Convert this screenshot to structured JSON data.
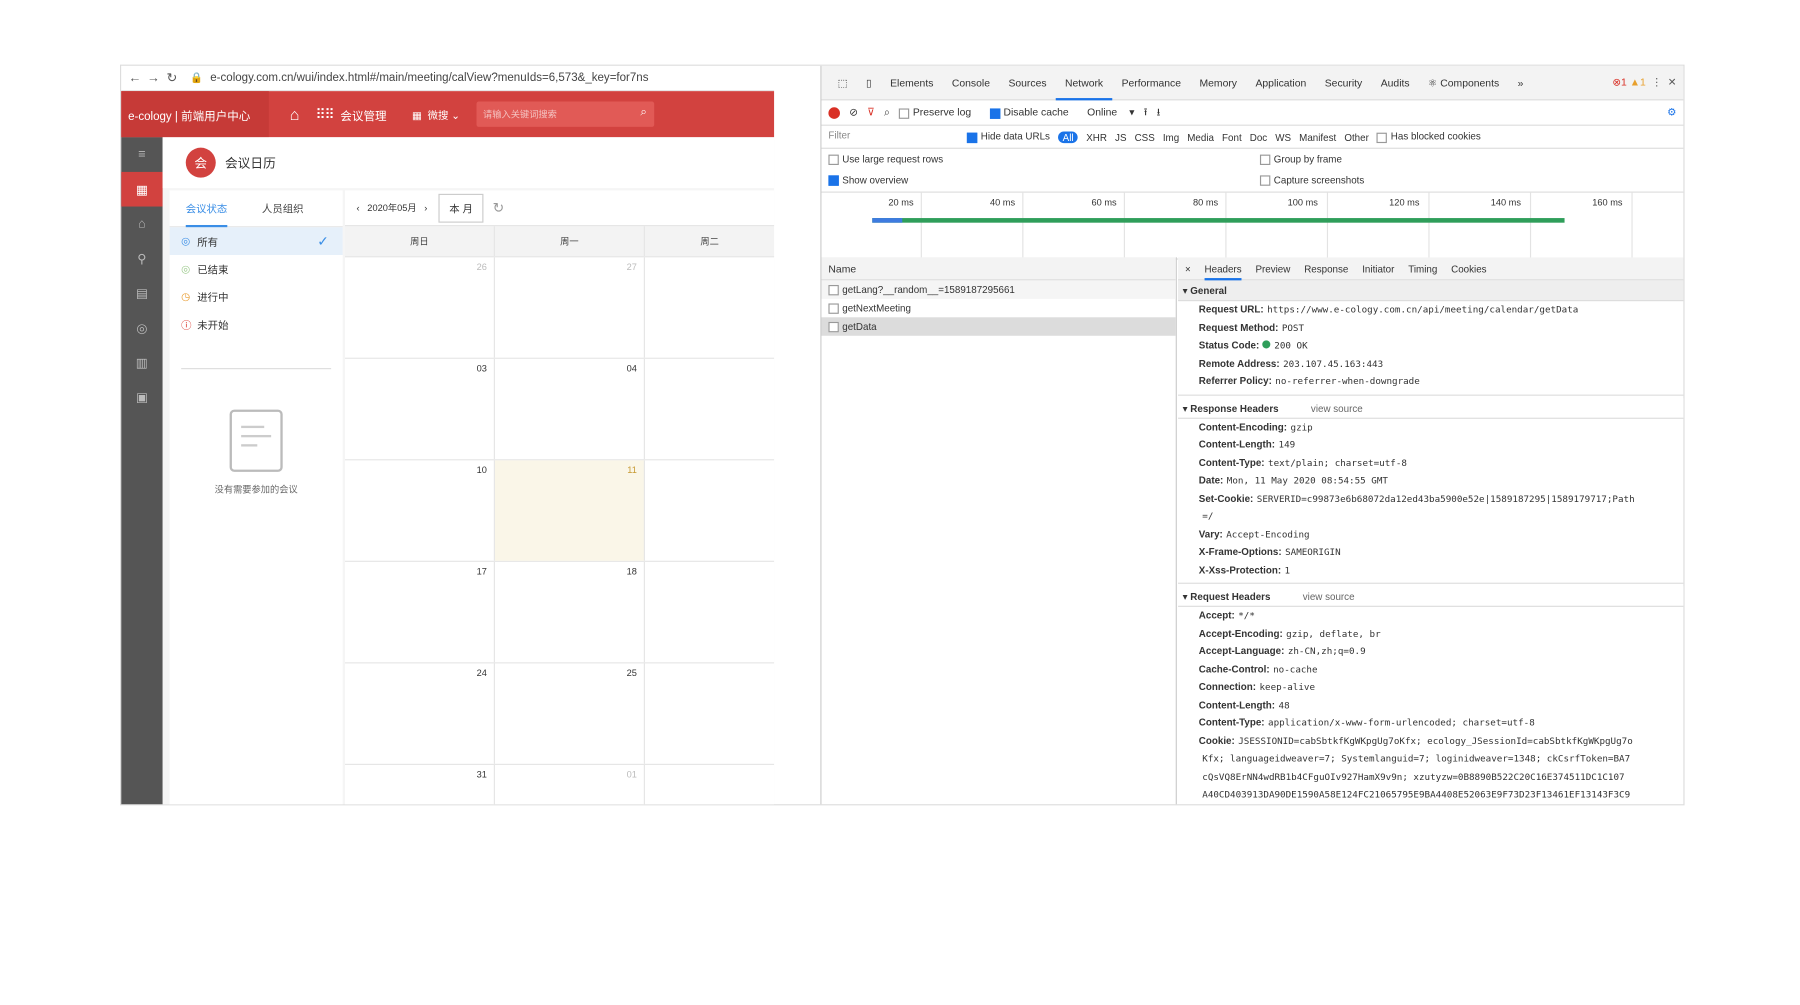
{
  "browser": {
    "url": "e-cology.com.cn/wui/index.html#/main/meeting/calView?menuIds=6,573&_key=for7ns"
  },
  "app": {
    "brand": "e-cology | 前端用户中心",
    "module": "会议管理",
    "selector": "微搜",
    "search_placeholder": "请输入关键词搜索"
  },
  "page": {
    "title": "会议日历",
    "logo": "会"
  },
  "filters": {
    "tabs": [
      "会议状态",
      "人员组织"
    ],
    "items": [
      "所有",
      "已结束",
      "进行中",
      "未开始"
    ],
    "empty": "没有需要参加的会议"
  },
  "calendar": {
    "month": "2020年05月",
    "today_button": "本 月",
    "weekdays": [
      "周日",
      "周一",
      "周二"
    ],
    "rows": [
      [
        "26",
        "27",
        ""
      ],
      [
        "03",
        "04",
        ""
      ],
      [
        "10",
        "11",
        ""
      ],
      [
        "17",
        "18",
        ""
      ],
      [
        "24",
        "25",
        ""
      ],
      [
        "31",
        "01",
        ""
      ]
    ]
  },
  "devtools": {
    "tabs": [
      "Elements",
      "Console",
      "Sources",
      "Network",
      "Performance",
      "Memory",
      "Application",
      "Security",
      "Audits",
      "Components",
      "»"
    ],
    "errors": "1",
    "warnings": "1",
    "controls": {
      "preserve": "Preserve log",
      "disable": "Disable cache",
      "online": "Online"
    },
    "filter": {
      "placeholder": "Filter",
      "hide": "Hide data URLs",
      "types": [
        "All",
        "XHR",
        "JS",
        "CSS",
        "Img",
        "Media",
        "Font",
        "Doc",
        "WS",
        "Manifest",
        "Other"
      ],
      "blocked": "Has blocked cookies"
    },
    "options": {
      "large": "Use large request rows",
      "overview": "Show overview",
      "group": "Group by frame",
      "capture": "Capture screenshots"
    },
    "ticks": [
      "20 ms",
      "40 ms",
      "60 ms",
      "80 ms",
      "100 ms",
      "120 ms",
      "140 ms",
      "160 ms"
    ],
    "name_header": "Name",
    "requests": [
      "getLang?__random__=1589187295661",
      "getNextMeeting",
      "getData"
    ],
    "htabs": [
      "×",
      "Headers",
      "Preview",
      "Response",
      "Initiator",
      "Timing",
      "Cookies"
    ],
    "general_label": "General",
    "general": [
      [
        "Request URL:",
        "https://www.e-cology.com.cn/api/meeting/calendar/getData"
      ],
      [
        "Request Method:",
        "POST"
      ],
      [
        "Status Code:",
        "200 OK"
      ],
      [
        "Remote Address:",
        "203.107.45.163:443"
      ],
      [
        "Referrer Policy:",
        "no-referrer-when-downgrade"
      ]
    ],
    "resp_label": "Response Headers",
    "view_source": "view source",
    "resp": [
      [
        "Content-Encoding:",
        "gzip"
      ],
      [
        "Content-Length:",
        "149"
      ],
      [
        "Content-Type:",
        "text/plain; charset=utf-8"
      ],
      [
        "Date:",
        "Mon, 11 May 2020 08:54:55 GMT"
      ],
      [
        "Set-Cookie:",
        "SERVERID=c99873e6b68072da12ed43ba5900e52e|1589187295|1589179717;Path"
      ],
      [
        "",
        "=/"
      ],
      [
        "Vary:",
        "Accept-Encoding"
      ],
      [
        "X-Frame-Options:",
        "SAMEORIGIN"
      ],
      [
        "X-Xss-Protection:",
        "1"
      ]
    ],
    "req_label": "Request Headers",
    "req": [
      [
        "Accept:",
        "*/*"
      ],
      [
        "Accept-Encoding:",
        "gzip, deflate, br"
      ],
      [
        "Accept-Language:",
        "zh-CN,zh;q=0.9"
      ],
      [
        "Cache-Control:",
        "no-cache"
      ],
      [
        "Connection:",
        "keep-alive"
      ],
      [
        "Content-Length:",
        "48"
      ],
      [
        "Content-Type:",
        "application/x-www-form-urlencoded; charset=utf-8"
      ],
      [
        "Cookie:",
        "JSESSIONID=cabSbtkfKgWKpgUg7oKfx; ecology_JSessionId=cabSbtkfKgWKpgUg7o"
      ],
      [
        "",
        "Kfx; languageidweaver=7; Systemlanguid=7; loginidweaver=1348; ckCsrfToken=BA7"
      ],
      [
        "",
        "cQsVQ8ErNN4wdRB1b4CFguOIv927HamX9v9n; xzutyzw=0B8890B522C20C16E374511DC1C107"
      ],
      [
        "",
        "A40CD403913DA90DE1590A58E124FC21065795E9BA4408E52063E9F73D23F13461EF13143F3C9"
      ]
    ]
  }
}
